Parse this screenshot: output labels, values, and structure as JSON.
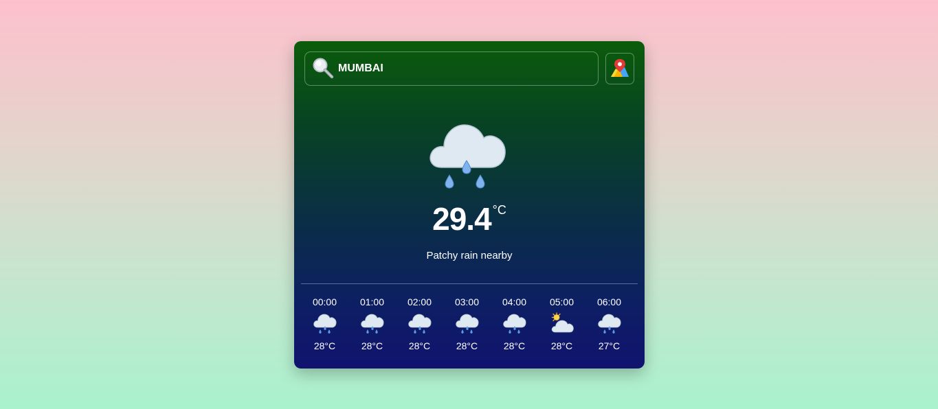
{
  "search": {
    "value": "MUMBAI",
    "icon": "search-icon"
  },
  "map_button": {
    "icon": "map-pin-icon"
  },
  "current": {
    "icon": "patchy-rain-icon",
    "temperature": "29.4",
    "unit": "°C",
    "condition": "Patchy rain nearby"
  },
  "hourly": [
    {
      "time": "00:00",
      "temp": "28°C",
      "icon": "rain-icon"
    },
    {
      "time": "01:00",
      "temp": "28°C",
      "icon": "rain-icon"
    },
    {
      "time": "02:00",
      "temp": "28°C",
      "icon": "rain-icon"
    },
    {
      "time": "03:00",
      "temp": "28°C",
      "icon": "rain-icon"
    },
    {
      "time": "04:00",
      "temp": "28°C",
      "icon": "rain-icon"
    },
    {
      "time": "05:00",
      "temp": "28°C",
      "icon": "partly-cloudy-icon"
    },
    {
      "time": "06:00",
      "temp": "27°C",
      "icon": "rain-icon"
    }
  ],
  "colors": {
    "background_top": "#fdc0cd",
    "background_bottom": "#a9f2cd",
    "card_top": "#0b5c0b",
    "card_bottom": "#11136f",
    "text": "#ffffff"
  }
}
